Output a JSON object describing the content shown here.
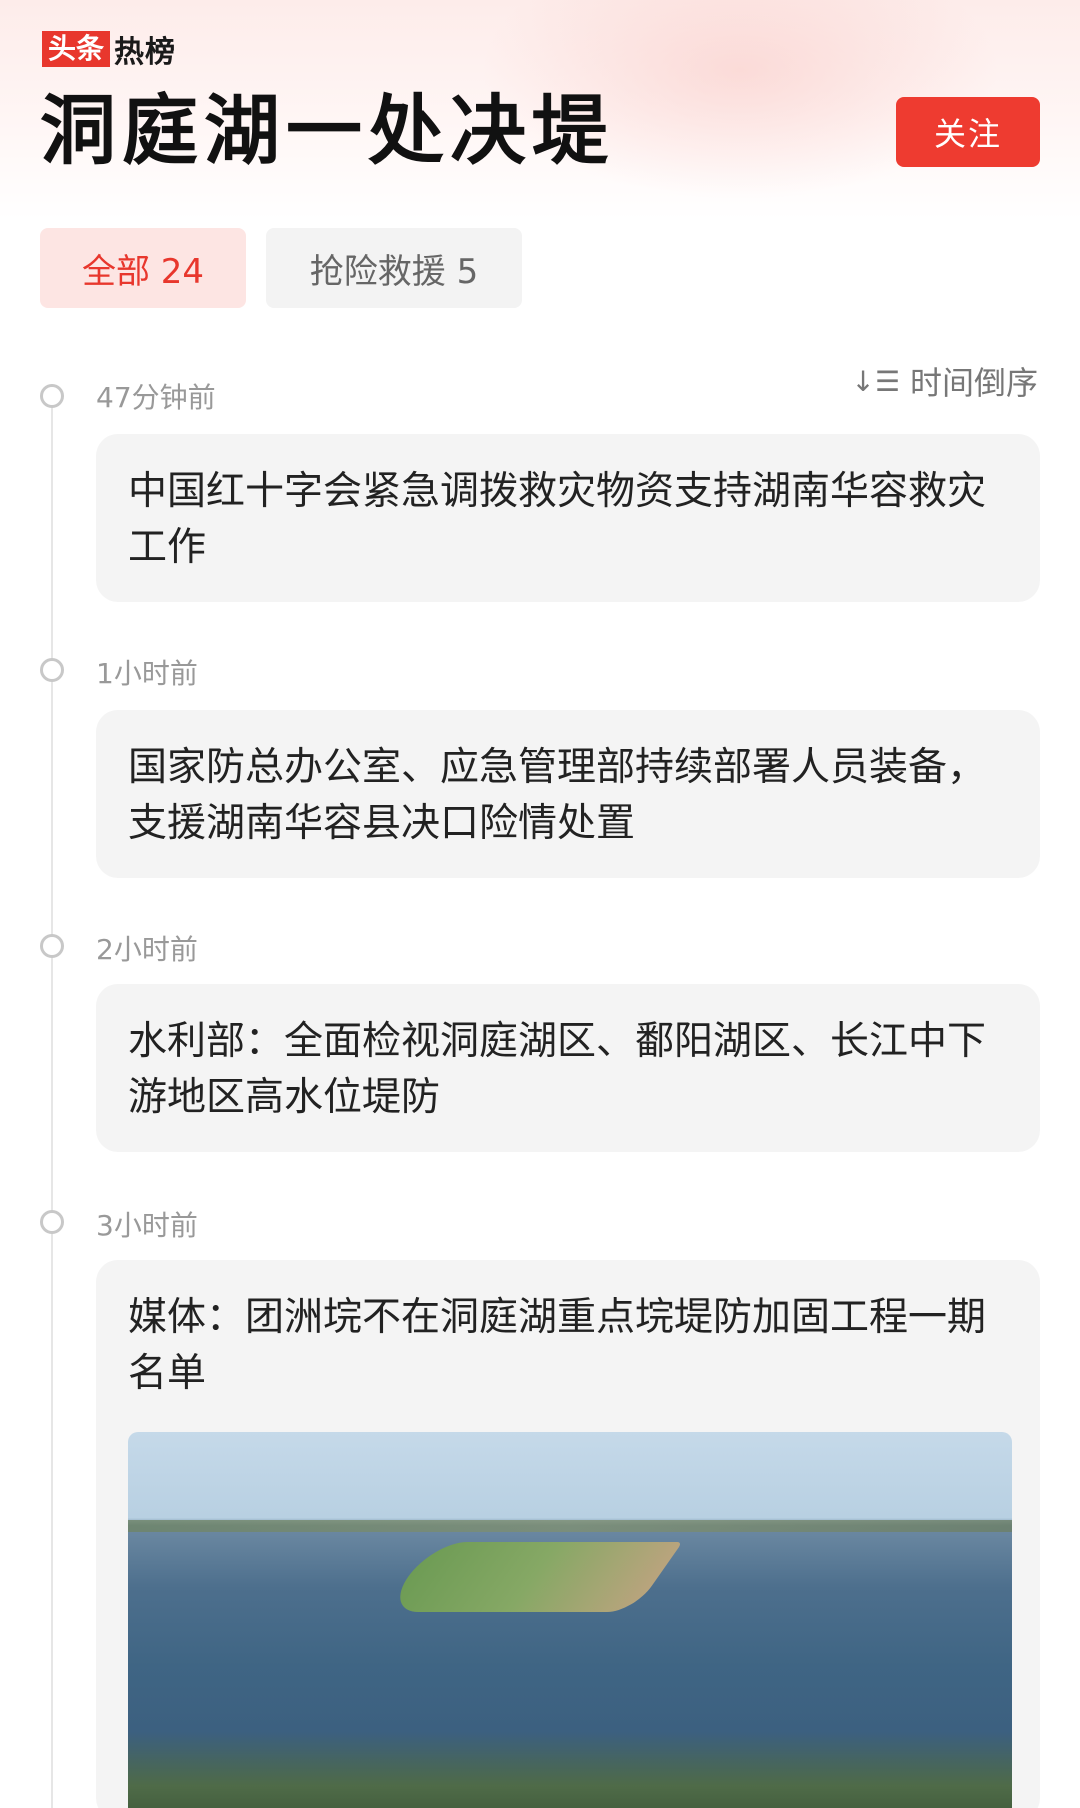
{
  "brand": {
    "box_text": "头条",
    "text": "热榜"
  },
  "header": {
    "title": "洞庭湖一处决堤",
    "follow_label": "关注"
  },
  "tabs": [
    {
      "label": "全部 24",
      "active": true
    },
    {
      "label": "抢险救援 5",
      "active": false
    }
  ],
  "sort": {
    "icon": "sort-desc-icon",
    "label": "时间倒序"
  },
  "timeline": [
    {
      "time": "47分钟前",
      "text": "中国红十字会紧急调拨救灾物资支持湖南华容救灾工作"
    },
    {
      "time": "1小时前",
      "text": "国家防总办公室、应急管理部持续部署人员装备，支援湖南华容县决口险情处置"
    },
    {
      "time": "2小时前",
      "text": "水利部：全面检视洞庭湖区、鄱阳湖区、长江中下游地区高水位堤防"
    },
    {
      "time": "3小时前",
      "text": "媒体：团洲垸不在洞庭湖重点垸堤防加固工程一期名单"
    }
  ],
  "colors": {
    "accent": "#ee3b30",
    "tab_active_bg": "#fde5e3",
    "card_bg": "#f4f4f4"
  }
}
